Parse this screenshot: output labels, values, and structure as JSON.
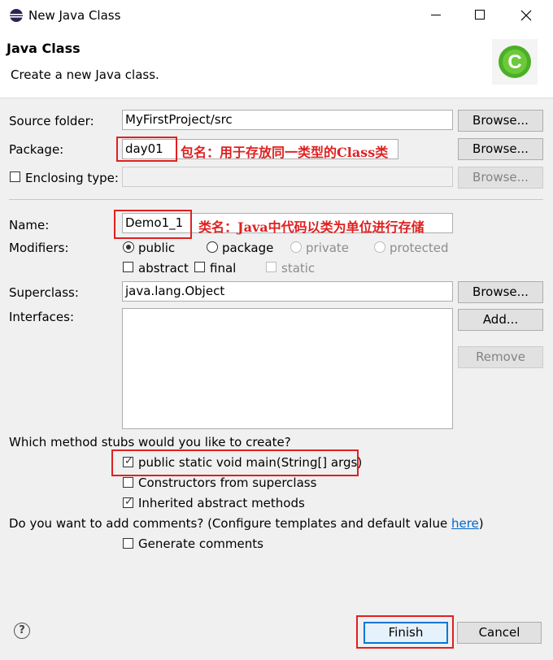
{
  "window": {
    "title": "New Java Class",
    "minimize_icon": "minimize-icon",
    "maximize_icon": "maximize-icon",
    "close_icon": "close-icon"
  },
  "banner": {
    "heading": "Java Class",
    "description": "Create a new Java class.",
    "wizard_icon": "java-class-wizard-icon"
  },
  "form": {
    "source_folder": {
      "label": "Source folder:",
      "value": "MyFirstProject/src",
      "browse": "Browse..."
    },
    "package": {
      "label": "Package:",
      "value": "day01",
      "browse": "Browse..."
    },
    "enclosing": {
      "label": "Enclosing type:",
      "checked": false,
      "value": "",
      "browse": "Browse..."
    },
    "name": {
      "label": "Name:",
      "value": "Demo1_1"
    },
    "modifiers": {
      "label": "Modifiers:",
      "radios": [
        {
          "label": "public",
          "selected": true,
          "enabled": true
        },
        {
          "label": "package",
          "selected": false,
          "enabled": true
        },
        {
          "label": "private",
          "selected": false,
          "enabled": false
        },
        {
          "label": "protected",
          "selected": false,
          "enabled": false
        }
      ],
      "checks": [
        {
          "label": "abstract",
          "checked": false,
          "enabled": true
        },
        {
          "label": "final",
          "checked": false,
          "enabled": true
        },
        {
          "label": "static",
          "checked": false,
          "enabled": false
        }
      ]
    },
    "superclass": {
      "label": "Superclass:",
      "value": "java.lang.Object",
      "browse": "Browse..."
    },
    "interfaces": {
      "label": "Interfaces:",
      "add": "Add...",
      "remove": "Remove"
    },
    "stubs": {
      "question": "Which method stubs would you like to create?",
      "options": [
        {
          "label": "public static void main(String[] args)",
          "checked": true
        },
        {
          "label": "Constructors from superclass",
          "checked": false
        },
        {
          "label": "Inherited abstract methods",
          "checked": true
        }
      ]
    },
    "comments": {
      "question": "Do you want to add comments? (Configure templates and default value ",
      "link": "here",
      "question_end": ")",
      "option": "Generate comments",
      "checked": false
    }
  },
  "annotations": {
    "package_note": "包名：用于存放同一类型的Class类",
    "name_note": "类名：Java中代码以类为单位进行存储",
    "color": "#e02020"
  },
  "footer": {
    "help_icon": "help-icon",
    "finish": "Finish",
    "cancel": "Cancel"
  }
}
